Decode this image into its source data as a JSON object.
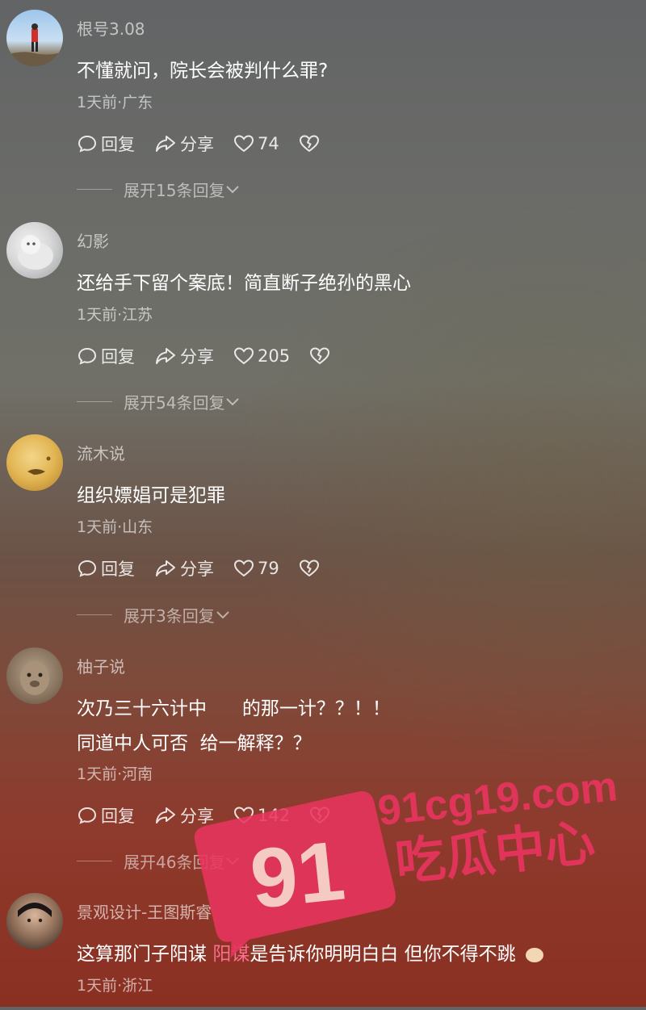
{
  "comments": [
    {
      "username": "根号3.08",
      "lines": [
        "不懂就问，院长会被判什么罪?"
      ],
      "meta": "1天前·广东",
      "reply_label": "回复",
      "share_label": "分享",
      "likes": "74",
      "expand": "展开15条回复"
    },
    {
      "username": "幻影",
      "lines": [
        "还给手下留个案底！简直断子绝孙的黑心"
      ],
      "meta": "1天前·江苏",
      "reply_label": "回复",
      "share_label": "分享",
      "likes": "205",
      "expand": "展开54条回复"
    },
    {
      "username": "流木说",
      "lines": [
        "组织嫖娼可是犯罪"
      ],
      "meta": "1天前·山东",
      "reply_label": "回复",
      "share_label": "分享",
      "likes": "79",
      "expand": "展开3条回复"
    },
    {
      "username": "柚子说",
      "lines": [
        "次乃三十六计中      的那一计？？！！",
        "同道中人可否  给一解释？？"
      ],
      "meta": "1天前·河南",
      "reply_label": "回复",
      "share_label": "分享",
      "likes": "142",
      "expand": "展开46条回复"
    },
    {
      "username": "景观设计-王图斯睿",
      "text_plain": "这算那门子阳谋 ",
      "text_highlight": "阳谋",
      "text_rest": "是告诉你明明白白 但你不得不跳",
      "meta": "1天前·浙江"
    }
  ],
  "watermark": {
    "badge_text": "91",
    "domain": "91cg19.com",
    "slogan": "吃瓜中心",
    "color": "#e8345f"
  }
}
